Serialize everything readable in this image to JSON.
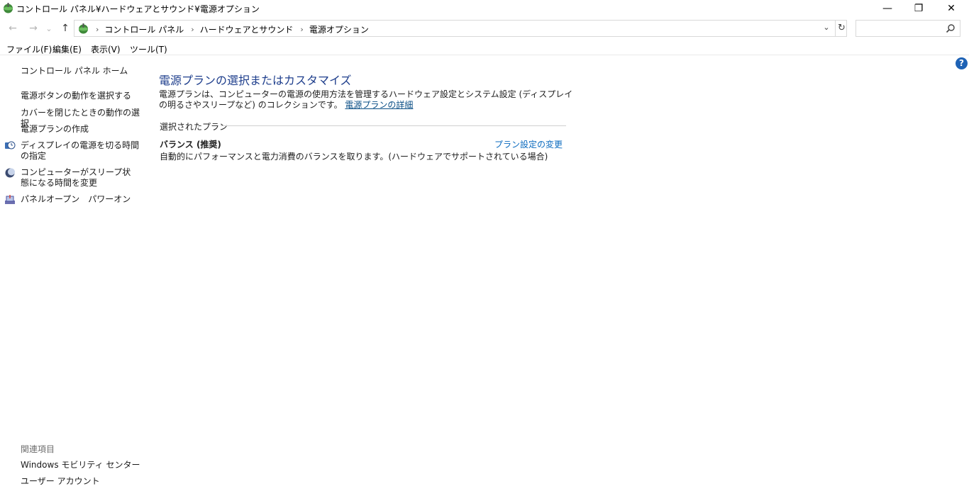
{
  "window": {
    "title": "コントロール パネル¥ハードウェアとサウンド¥電源オプション",
    "minimize": "—",
    "restore": "❐",
    "close": "✕"
  },
  "nav": {
    "back": "←",
    "forward": "→",
    "recent": "⌄",
    "up": "↑"
  },
  "address": {
    "sep": "›",
    "crumbs": [
      "コントロール パネル",
      "ハードウェアとサウンド",
      "電源オプション"
    ],
    "dropdown": "⌄",
    "refresh": "↻"
  },
  "search": {
    "placeholder": "",
    "value": ""
  },
  "menu": {
    "file": "ファイル(F)",
    "edit": "編集(E)",
    "view": "表示(V)",
    "tools": "ツール(T)"
  },
  "help": "?",
  "sidebar": {
    "home": "コントロール パネル ホーム",
    "links": [
      "電源ボタンの動作を選択する",
      "カバーを閉じたときの動作の選択",
      "電源プランの作成",
      "ディスプレイの電源を切る時間の指定",
      "コンピューターがスリープ状態になる時間を変更",
      "パネルオープン　パワーオン"
    ],
    "related_title": "関連項目",
    "related": [
      "Windows モビリティ センター",
      "ユーザー アカウント"
    ]
  },
  "main": {
    "heading": "電源プランの選択またはカスタマイズ",
    "description": "電源プランは、コンピューターの電源の使用方法を管理するハードウェア設定とシステム設定 (ディスプレイの明るさやスリープなど) のコレクションです。",
    "details_link": "電源プランの詳細",
    "selected_plan_label": "選択されたプラン",
    "plan_name": "バランス (推奨)",
    "plan_description": "自動的にパフォーマンスと電力消費のバランスを取ります。(ハードウェアでサポートされている場合)",
    "plan_settings_link": "プラン設定の変更"
  }
}
